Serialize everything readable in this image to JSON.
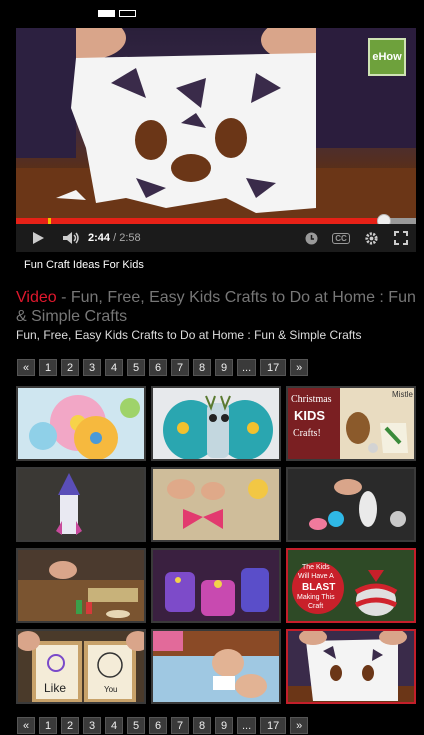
{
  "slider": {
    "dots": [
      {
        "active": true
      },
      {
        "active": false
      }
    ]
  },
  "player": {
    "brand": "eHow",
    "time_current": "2:44",
    "time_separator": " / ",
    "time_total": "2:58",
    "progress_fraction": 0.92,
    "icons": [
      "play-icon",
      "volume-icon",
      "watch-later-icon",
      "captions-icon",
      "settings-icon",
      "fullscreen-icon"
    ],
    "cc_label": "CC"
  },
  "video_title": "Fun Craft Ideas For Kids",
  "heading": {
    "lead": "Video",
    "rest": " - Fun, Free, Easy Kids Crafts to Do at Home : Fun & Simple Crafts"
  },
  "subheading": "Fun, Free, Easy Kids Crafts to Do at Home : Fun & Simple Crafts",
  "pager": {
    "items": [
      "«",
      "1",
      "2",
      "3",
      "4",
      "5",
      "6",
      "7",
      "8",
      "9",
      "...",
      "17",
      "»"
    ]
  },
  "thumbs": [
    {
      "id": "paper-flowers"
    },
    {
      "id": "bottle-peacock"
    },
    {
      "id": "christmas-kids-crafts",
      "text1": "Christmas",
      "text2": "KIDS",
      "text3": "Crafts!",
      "text4": "Mistle"
    },
    {
      "id": "paper-rocket"
    },
    {
      "id": "paper-bow"
    },
    {
      "id": "clay-figures"
    },
    {
      "id": "table-craft"
    },
    {
      "id": "cupcake-houses"
    },
    {
      "id": "blast-ornament",
      "text1": "The Kids",
      "text2": "Will Have A",
      "text3": "BLAST",
      "text4": "Making This",
      "text5": "Craft"
    },
    {
      "id": "like-frame",
      "text1": "Like",
      "text2": "You"
    },
    {
      "id": "folding-paper"
    },
    {
      "id": "paper-snowflake",
      "selected": true
    }
  ],
  "colors": {
    "accent": "#e0182d",
    "progress": "#e62117",
    "selected_border": "#c41e2a"
  }
}
